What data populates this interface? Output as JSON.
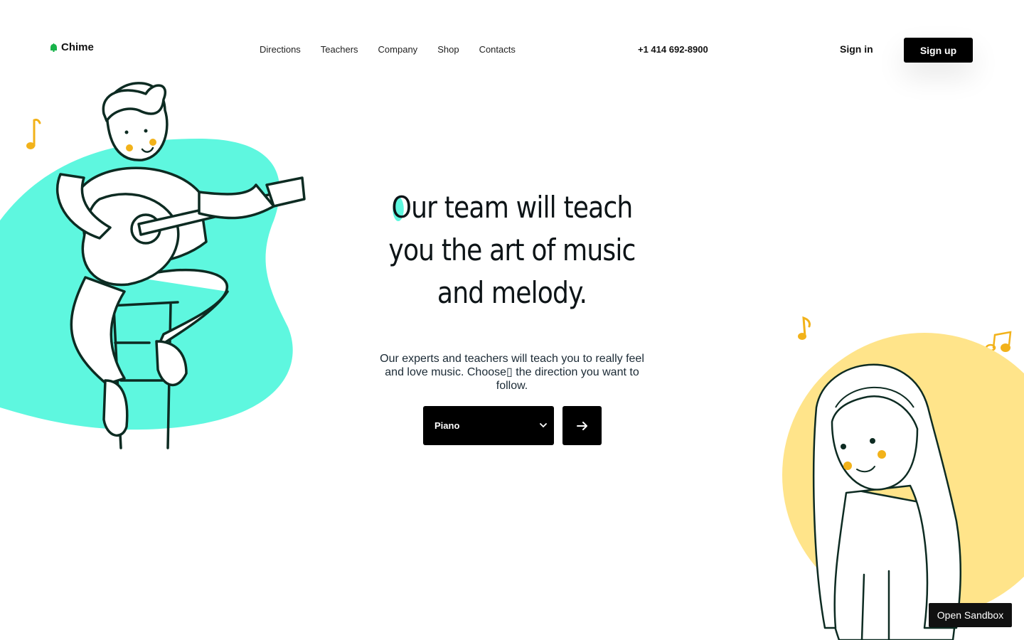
{
  "brand": {
    "name": "Chime",
    "icon": "bell-icon",
    "icon_color": "#18b34a"
  },
  "nav": {
    "items": [
      "Directions",
      "Teachers",
      "Company",
      "Shop",
      "Contacts"
    ]
  },
  "header": {
    "phone": "+1 414 692-8900",
    "signin_label": "Sign in",
    "signup_label": "Sign up"
  },
  "hero": {
    "headline_first": "O",
    "headline_rest": "ur team will teach you the art of music and melody.",
    "description": "Our experts and teachers will teach you to really feel and love music. Choose▯ the direction you want to follow.",
    "select_value": "Piano",
    "go_icon": "arrow-right-icon"
  },
  "sandbox_label": "Open Sandbox",
  "colors": {
    "accent_mint": "#5ef7df",
    "accent_yellow": "#ffe48a",
    "note_orange": "#f2b21a",
    "button_black": "#000000"
  }
}
